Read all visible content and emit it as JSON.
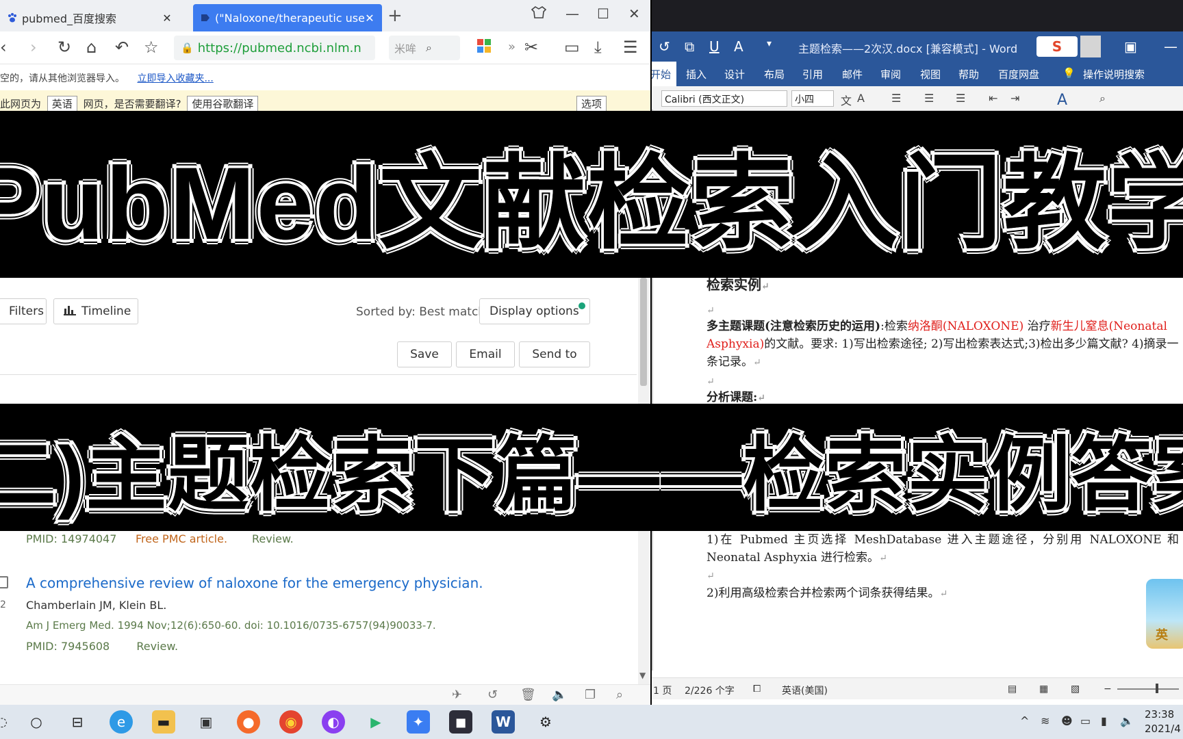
{
  "browser": {
    "tabs": [
      {
        "title": "pubmed_百度搜索",
        "active": false
      },
      {
        "title": "(\"Naloxone/therapeutic use\"[",
        "active": true
      }
    ],
    "url": "https://pubmed.ncbi.nlm.n",
    "search_placeholder": "米哞",
    "bookmark_notice": "空的，请从其他浏览器导入。",
    "bookmark_link": "立即导入收藏夹...",
    "translate_prefix": "此网页为",
    "translate_lang": "英语",
    "translate_mid": "网页，是否需要翻译?",
    "translate_button": "使用谷歌翻译",
    "translate_options": "选项"
  },
  "pubmed": {
    "filters_label": "Filters",
    "timeline_label": "Timeline",
    "sorted_label": "Sorted by: Best match",
    "display_options_label": "Display options",
    "save_label": "Save",
    "email_label": "Email",
    "send_to_label": "Send to",
    "prev_result": {
      "pmid": "PMID: 14974047",
      "free": "Free PMC article.",
      "type": "Review."
    },
    "result": {
      "index": "2",
      "title": "A comprehensive review of naloxone for the emergency physician.",
      "authors": "Chamberlain JM, Klein BL.",
      "journal": "Am J Emerg Med. 1994 Nov;12(6):650-60. doi: 10.1016/0735-6757(94)90033-7.",
      "pmid": "PMID: 7945608",
      "type": "Review."
    }
  },
  "word": {
    "doc_title": "主题检索——2次汉.docx [兼容模式] - Word",
    "ribbon_tabs": [
      "开始",
      "插入",
      "设计",
      "布局",
      "引用",
      "邮件",
      "审阅",
      "视图",
      "帮助",
      "百度网盘",
      "操作说明搜索"
    ],
    "font_name": "Calibri (西文正文)",
    "font_size": "小四",
    "heading": "检索实例",
    "para1_bold": "多主题课题(注意检索历史的运用)",
    "para1_a": ":检索",
    "para1_red1": "纳洛酮(NALOXONE)",
    "para1_b": " 治疗",
    "para1_red2": "新生儿窒息",
    "para1_red3": "(Neonatal Asphyxia)",
    "para1_c": "的文献。要求: 1)写出检索途径; 2)写出检索表达式;3)检出多少篇文献? 4)摘录一条记录。",
    "analysis_label": "分析课题:",
    "step1": "1)在 Pubmed 主页选择 MeshDatabase 进入主题途径，分别用 NALOXONE 和 Neonatal Asphyxia 进行检索。",
    "step2": "2)利用高级检索合并检索两个词条获得结果。",
    "status_page": "1 页",
    "status_words": "2/226 个字",
    "status_lang": "英语(美国)",
    "floater_label": "英"
  },
  "banner": {
    "title": "PubMed文献检索入门教学",
    "subtitle": "(二)主题检索下篇——检索实例答案"
  },
  "taskbar": {
    "time": "23:38",
    "date": "2021/4"
  },
  "colors": {
    "word_blue": "#2b579a",
    "link_blue": "#1b6ac9",
    "free_pmc": "#c0651b",
    "meta_green": "#5b7a4a",
    "red_text": "#e0201c"
  }
}
